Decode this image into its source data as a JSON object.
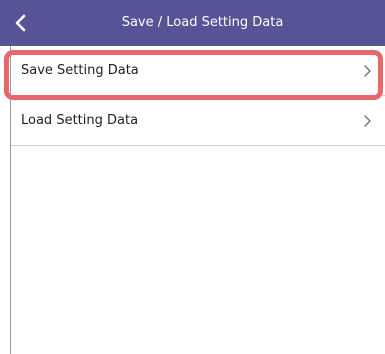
{
  "header": {
    "title": "Save / Load Setting Data",
    "back_icon": "chevron-left-icon",
    "background": "#565397"
  },
  "list": {
    "items": [
      {
        "label": "Save Setting Data",
        "icon": "chevron-right-icon",
        "highlighted": true
      },
      {
        "label": "Load Setting Data",
        "icon": "chevron-right-icon",
        "highlighted": false
      }
    ]
  },
  "colors": {
    "highlight": "#e8676b",
    "header": "#565397"
  }
}
